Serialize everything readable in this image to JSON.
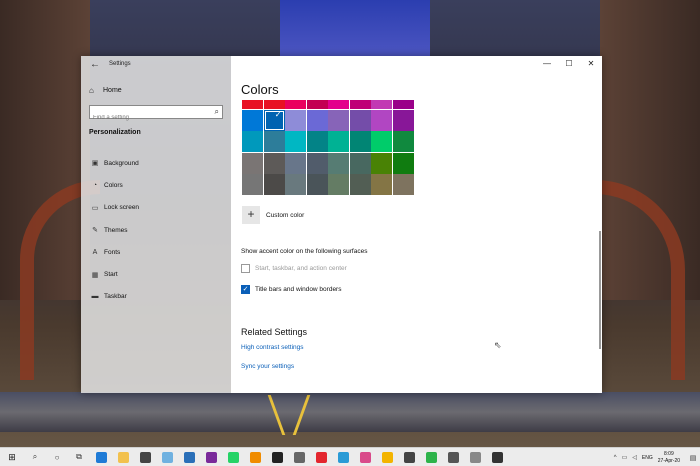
{
  "window": {
    "app_title": "Settings",
    "controls": {
      "minimize": "—",
      "maximize": "☐",
      "close": "✕"
    }
  },
  "sidebar": {
    "home_label": "Home",
    "search_placeholder": "Find a setting",
    "section_title": "Personalization",
    "items": [
      {
        "label": "Background",
        "icon": "picture-icon",
        "glyph": "▣"
      },
      {
        "label": "Colors",
        "icon": "palette-icon",
        "glyph": "◔"
      },
      {
        "label": "Lock screen",
        "icon": "lock-screen-icon",
        "glyph": "▭"
      },
      {
        "label": "Themes",
        "icon": "brush-icon",
        "glyph": "✎"
      },
      {
        "label": "Fonts",
        "icon": "font-icon",
        "glyph": "A"
      },
      {
        "label": "Start",
        "icon": "start-grid-icon",
        "glyph": "▦"
      },
      {
        "label": "Taskbar",
        "icon": "taskbar-icon",
        "glyph": "▬"
      }
    ]
  },
  "content": {
    "page_title": "Colors",
    "swatch_rows": [
      [
        "#e81123",
        "#e81123",
        "#ea005e",
        "#c30052",
        "#e3008c",
        "#bf0077",
        "#c239b3",
        "#9a0089"
      ],
      [
        "#0078d7",
        "#0063b1",
        "#8e8cd8",
        "#6b69d6",
        "#8764b8",
        "#744da9",
        "#b146c2",
        "#881798"
      ],
      [
        "#0099bc",
        "#2d7d9a",
        "#00b7c3",
        "#038387",
        "#00b294",
        "#018574",
        "#00cc6a",
        "#10893e"
      ],
      [
        "#7a7574",
        "#5d5a58",
        "#68768a",
        "#515c6b",
        "#567c73",
        "#486860",
        "#498205",
        "#107c10"
      ],
      [
        "#767676",
        "#4c4a48",
        "#69797e",
        "#4a5459",
        "#647c64",
        "#525e54",
        "#847545",
        "#7e735f"
      ]
    ],
    "selected_swatch": {
      "row": 1,
      "col": 1
    },
    "custom_color_label": "Custom color",
    "accent_surfaces_title": "Show accent color on the following surfaces",
    "checkbox_start": {
      "label": "Start, taskbar, and action center",
      "checked": false,
      "disabled": true
    },
    "checkbox_title_bars": {
      "label": "Title bars and window borders",
      "checked": true
    },
    "related_title": "Related Settings",
    "links": [
      "High contrast settings",
      "Sync your settings"
    ]
  },
  "taskbar": {
    "apps": [
      {
        "icon": "edge-icon",
        "color": "#1f7bd6"
      },
      {
        "icon": "file-explorer-icon",
        "color": "#f2c14e"
      },
      {
        "icon": "store-icon",
        "color": "#444444"
      },
      {
        "icon": "notepad-icon",
        "color": "#6fb1e0"
      },
      {
        "icon": "mail-icon",
        "color": "#2a6fb8"
      },
      {
        "icon": "onenote-icon",
        "color": "#7a2a9a"
      },
      {
        "icon": "whatsapp-icon",
        "color": "#25d366"
      },
      {
        "icon": "vlc-icon",
        "color": "#f08c00"
      },
      {
        "icon": "terminal-icon",
        "color": "#222222"
      },
      {
        "icon": "photos-icon",
        "color": "#666666"
      },
      {
        "icon": "opera-icon",
        "color": "#e3262e"
      },
      {
        "icon": "browser-icon",
        "color": "#2a9bd6"
      },
      {
        "icon": "paint-icon",
        "color": "#d94a8a"
      },
      {
        "icon": "chrome-icon",
        "color": "#f3b400"
      },
      {
        "icon": "bag-icon",
        "color": "#444444"
      },
      {
        "icon": "green-app-icon",
        "color": "#2db34a"
      },
      {
        "icon": "settings-icon",
        "color": "#555555"
      },
      {
        "icon": "calendar-icon",
        "color": "#888888"
      },
      {
        "icon": "media-icon",
        "color": "#333333"
      }
    ],
    "language": "ENG",
    "time": "8:09",
    "date": "27-Apr-20"
  }
}
